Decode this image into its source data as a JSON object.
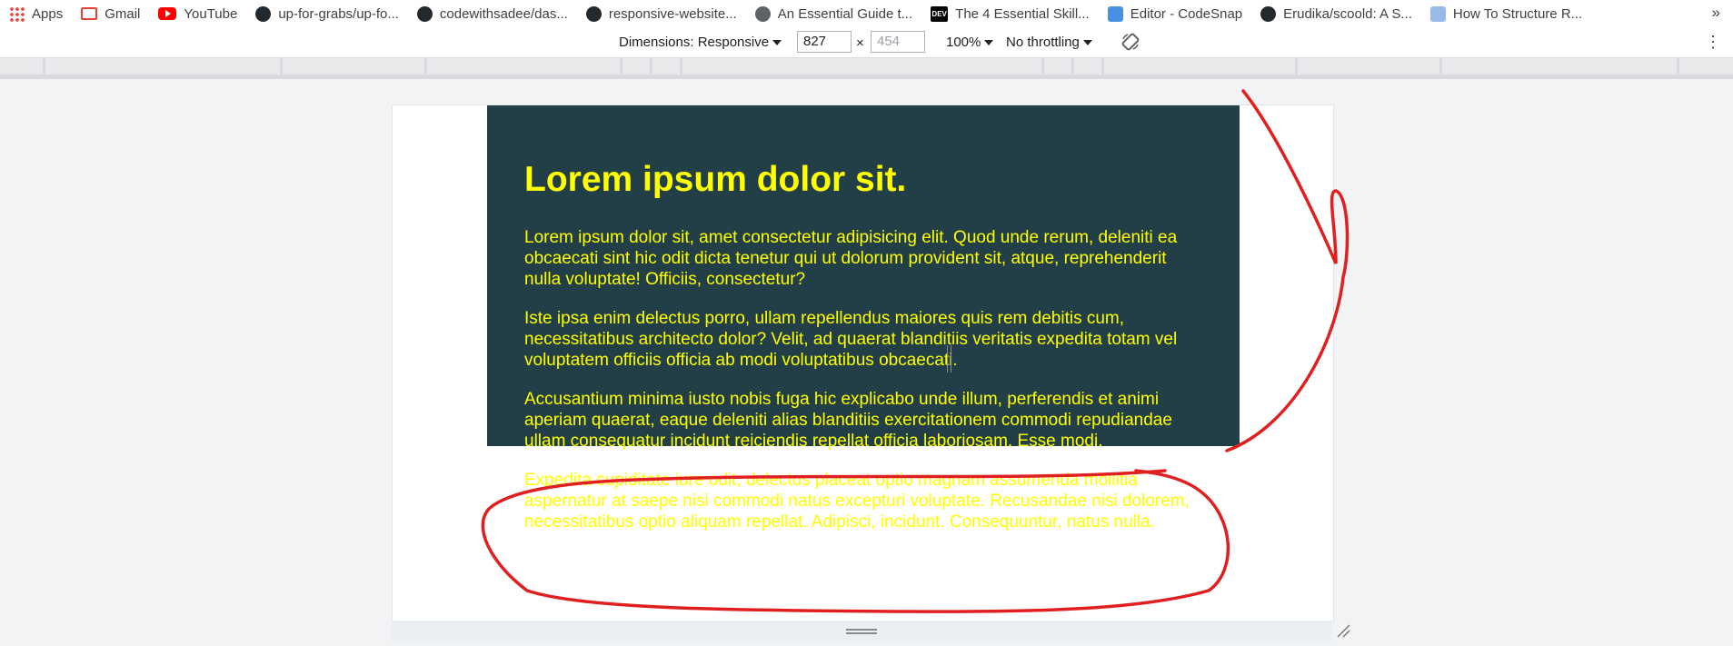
{
  "bookmarks": [
    {
      "label": "Apps",
      "icon": "apps-grid-icon"
    },
    {
      "label": "Gmail",
      "icon": "gmail-icon"
    },
    {
      "label": "YouTube",
      "icon": "youtube-icon"
    },
    {
      "label": "up-for-grabs/up-fo...",
      "icon": "github-icon"
    },
    {
      "label": "codewithsadee/das...",
      "icon": "github-icon"
    },
    {
      "label": "responsive-website...",
      "icon": "github-icon"
    },
    {
      "label": "An Essential Guide t...",
      "icon": "globe-icon"
    },
    {
      "label": "The 4 Essential Skill...",
      "icon": "dev-icon"
    },
    {
      "label": "Editor - CodeSnap",
      "icon": "codesnap-icon"
    },
    {
      "label": "Erudika/scoold: A S...",
      "icon": "github-icon"
    },
    {
      "label": "How To Structure R...",
      "icon": "site-icon"
    }
  ],
  "device_toolbar": {
    "dimensions_label": "Dimensions: Responsive",
    "width_value": "827",
    "times": "×",
    "height_value": "454",
    "zoom": "100%",
    "throttling": "No throttling"
  },
  "page": {
    "heading": "Lorem ipsum dolor sit.",
    "paragraphs": [
      "Lorem ipsum dolor sit, amet consectetur adipisicing elit. Quod unde rerum, deleniti ea obcaecati sint hic odit dicta tenetur qui ut dolorum provident sit, atque, reprehenderit nulla voluptate! Officiis, consectetur?",
      "Iste ipsa enim delectus porro, ullam repellendus maiores quis rem debitis cum, necessitatibus architecto dolor? Velit, ad quaerat blanditiis veritatis expedita totam vel voluptatem officiis officia ab modi voluptatibus obcaecati.",
      "Accusantium minima iusto nobis fuga hic explicabo unde illum, perferendis et animi aperiam quaerat, eaque deleniti alias blanditiis exercitationem commodi repudiandae ullam consequatur incidunt reiciendis repellat officia laboriosam. Esse modi.",
      "Expedita cupiditate iure odit, delectus placeat optio magnam assumenda mollitia aspernatur at saepe nisi commodi natus excepturi voluptate. Recusandae nisi dolorem, necessitatibus optio aliquam repellat. Adipisci, incidunt. Consequuntur, natus nulla."
    ],
    "panel_color": "#223f47",
    "text_color": "#ffff00"
  },
  "annotation_color": "#e02020"
}
